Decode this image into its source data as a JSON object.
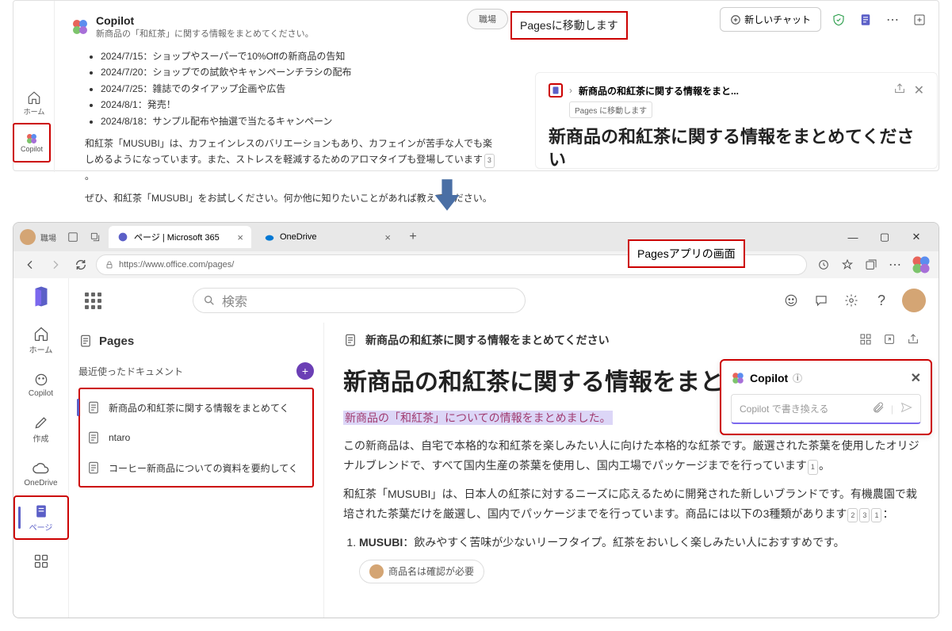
{
  "topApp": {
    "brand": "Copilot",
    "subtitle": "新商品の「和紅茶」に関する情報をまとめてください。",
    "sidebar": {
      "home": "ホーム",
      "copilot": "Copilot"
    },
    "pill": "職場",
    "newChat": "新しいチャット",
    "bullets": [
      "2024/7/15：ショップやスーパーで10%Offの新商品の告知",
      "2024/7/20：ショップでの試飲やキャンペーンチラシの配布",
      "2024/7/25：雑誌でのタイアップ企画や広告",
      "2024/8/1：発売！",
      "2024/8/18：サンプル配布や抽選で当たるキャンペーン"
    ],
    "p1": "和紅茶「MUSUBI」は、カフェインレスのバリエーションもあり、カフェインが苦手な人でも楽しめるようになっています。また、ストレスを軽減するためのアロマタイプも登場しています",
    "p1ref": "3",
    "p2": "ぜひ、和紅茶「MUSUBI」をお試しください。何か他に知りたいことがあれば教えてください。"
  },
  "annot1": "Pagesに移動します",
  "pagesCard": {
    "breadcrumb": "新商品の和紅茶に関する情報をまと...",
    "tooltip": "Pages に移動します",
    "title": "新商品の和紅茶に関する情報をまとめてください"
  },
  "annot2": "Pagesアプリの画面",
  "browser": {
    "profile": "職場",
    "tab1": "ページ | Microsoft 365",
    "tab2": "OneDrive",
    "url": "https://www.office.com/pages/"
  },
  "m365": {
    "search": "検索",
    "rail": {
      "home": "ホーム",
      "copilot": "Copilot",
      "create": "作成",
      "onedrive": "OneDrive",
      "pages": "ページ"
    },
    "left": {
      "title": "Pages",
      "recent": "最近使ったドキュメント",
      "docs": [
        "新商品の和紅茶に関する情報をまとめてく",
        "ntaro",
        "コーヒー新商品についての資料を要約してく"
      ]
    },
    "main": {
      "breadcrumb": "新商品の和紅茶に関する情報をまとめてください",
      "title": "新商品の和紅茶に関する情報をまとめてください",
      "highlight": "新商品の「和紅茶」についての情報をまとめました。",
      "p1a": "この新商品は、自宅で本格的な和紅茶を楽しみたい人に向けた本格的な紅茶です。厳選された茶葉を使用したオリジナルブレンドで、すべて国内生産の茶葉を使用し、国内工場でパッケージまでを行っています",
      "p1refs": [
        "1"
      ],
      "p1b": "。",
      "p2a": "和紅茶「MUSUBI」は、日本人の紅茶に対するニーズに応えるために開発された新しいブランドです。有機農園で栽培された茶葉だけを厳選し、国内でパッケージまでを行っています。商品には以下の3種類があります",
      "p2refs": [
        "2",
        "3",
        "1"
      ],
      "p2b": "：",
      "li1b": "MUSUBI",
      "li1": "：飲みやすく苦味が少ないリーフタイプ。紅茶をおいしく楽しみたい人におすすめです。",
      "chip": "商品名は確認が必要"
    }
  },
  "copilotPanel": {
    "title": "Copilot",
    "placeholder": "Copilot で書き換える"
  }
}
